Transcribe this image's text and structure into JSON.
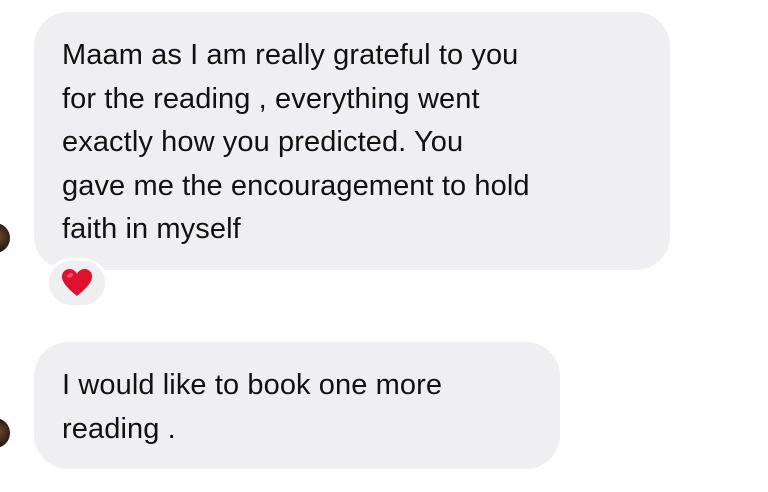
{
  "conversation": {
    "messages": [
      {
        "lines": [
          "Maam as I am really grateful to you",
          "for the reading , everything went",
          "exactly how you predicted. You",
          "gave me the encouragement to hold",
          "faith in myself"
        ],
        "reaction": {
          "icon": "red-heart-icon",
          "color": "#e0102e"
        }
      },
      {
        "lines": [
          "I would like to book one more",
          "reading ."
        ]
      }
    ],
    "colors": {
      "bubble_background": "#efeff1",
      "text": "#111111"
    }
  }
}
